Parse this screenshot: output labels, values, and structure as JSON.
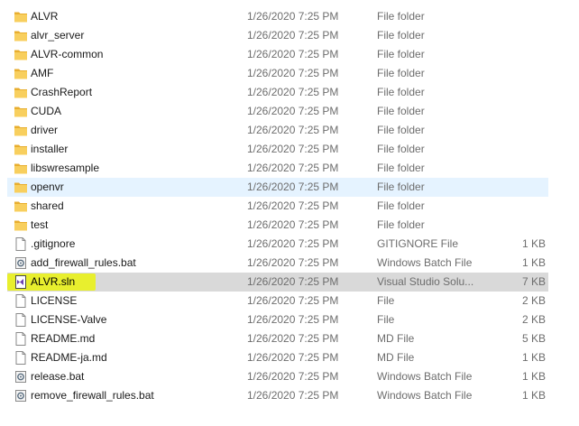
{
  "files": [
    {
      "name": "ALVR",
      "date": "1/26/2020 7:25 PM",
      "type": "File folder",
      "size": "",
      "icon": "folder-icon",
      "state": ""
    },
    {
      "name": "alvr_server",
      "date": "1/26/2020 7:25 PM",
      "type": "File folder",
      "size": "",
      "icon": "folder-icon",
      "state": ""
    },
    {
      "name": "ALVR-common",
      "date": "1/26/2020 7:25 PM",
      "type": "File folder",
      "size": "",
      "icon": "folder-icon",
      "state": ""
    },
    {
      "name": "AMF",
      "date": "1/26/2020 7:25 PM",
      "type": "File folder",
      "size": "",
      "icon": "folder-icon",
      "state": ""
    },
    {
      "name": "CrashReport",
      "date": "1/26/2020 7:25 PM",
      "type": "File folder",
      "size": "",
      "icon": "folder-icon",
      "state": ""
    },
    {
      "name": "CUDA",
      "date": "1/26/2020 7:25 PM",
      "type": "File folder",
      "size": "",
      "icon": "folder-icon",
      "state": ""
    },
    {
      "name": "driver",
      "date": "1/26/2020 7:25 PM",
      "type": "File folder",
      "size": "",
      "icon": "folder-icon",
      "state": ""
    },
    {
      "name": "installer",
      "date": "1/26/2020 7:25 PM",
      "type": "File folder",
      "size": "",
      "icon": "folder-icon",
      "state": ""
    },
    {
      "name": "libswresample",
      "date": "1/26/2020 7:25 PM",
      "type": "File folder",
      "size": "",
      "icon": "folder-icon",
      "state": ""
    },
    {
      "name": "openvr",
      "date": "1/26/2020 7:25 PM",
      "type": "File folder",
      "size": "",
      "icon": "folder-icon",
      "state": "hover"
    },
    {
      "name": "shared",
      "date": "1/26/2020 7:25 PM",
      "type": "File folder",
      "size": "",
      "icon": "folder-icon",
      "state": ""
    },
    {
      "name": "test",
      "date": "1/26/2020 7:25 PM",
      "type": "File folder",
      "size": "",
      "icon": "folder-icon",
      "state": ""
    },
    {
      "name": ".gitignore",
      "date": "1/26/2020 7:25 PM",
      "type": "GITIGNORE File",
      "size": "1 KB",
      "icon": "file-icon",
      "state": ""
    },
    {
      "name": "add_firewall_rules.bat",
      "date": "1/26/2020 7:25 PM",
      "type": "Windows Batch File",
      "size": "1 KB",
      "icon": "batch-file-icon",
      "state": ""
    },
    {
      "name": "ALVR.sln",
      "date": "1/26/2020 7:25 PM",
      "type": "Visual Studio Solu...",
      "size": "7 KB",
      "icon": "visual-studio-solution-icon",
      "state": "selected"
    },
    {
      "name": "LICENSE",
      "date": "1/26/2020 7:25 PM",
      "type": "File",
      "size": "2 KB",
      "icon": "file-icon",
      "state": ""
    },
    {
      "name": "LICENSE-Valve",
      "date": "1/26/2020 7:25 PM",
      "type": "File",
      "size": "2 KB",
      "icon": "file-icon",
      "state": ""
    },
    {
      "name": "README.md",
      "date": "1/26/2020 7:25 PM",
      "type": "MD File",
      "size": "5 KB",
      "icon": "file-icon",
      "state": ""
    },
    {
      "name": "README-ja.md",
      "date": "1/26/2020 7:25 PM",
      "type": "MD File",
      "size": "1 KB",
      "icon": "file-icon",
      "state": ""
    },
    {
      "name": "release.bat",
      "date": "1/26/2020 7:25 PM",
      "type": "Windows Batch File",
      "size": "1 KB",
      "icon": "batch-file-icon",
      "state": ""
    },
    {
      "name": "remove_firewall_rules.bat",
      "date": "1/26/2020 7:25 PM",
      "type": "Windows Batch File",
      "size": "1 KB",
      "icon": "batch-file-icon",
      "state": ""
    }
  ],
  "colors": {
    "hover_row": "#e5f3ff",
    "selected_row": "#d9d9d9",
    "highlight_marker": "#e8ef2e",
    "folder": "#f3c14b",
    "secondary_text": "#6d6d6d"
  }
}
